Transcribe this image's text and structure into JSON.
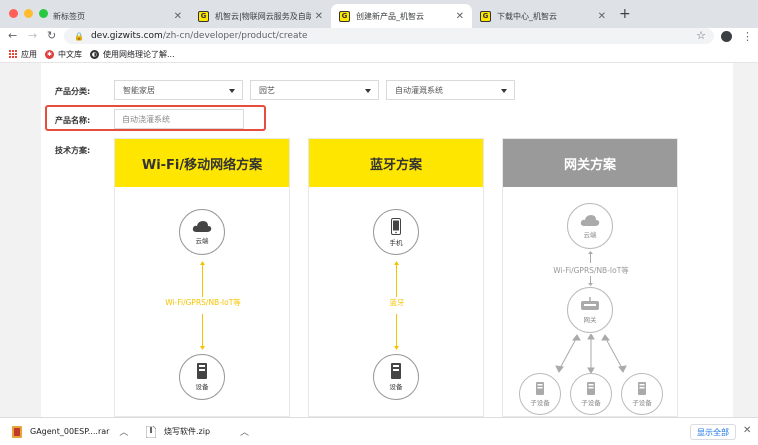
{
  "browser": {
    "tabs": [
      {
        "title": "新标签页",
        "active": false,
        "icon": "none"
      },
      {
        "title": "机智云|物联网云服务及自助开发",
        "active": false,
        "icon": "gizwits-favicon"
      },
      {
        "title": "创建新产品_机智云",
        "active": true,
        "icon": "gizwits-favicon"
      },
      {
        "title": "下载中心_机智云",
        "active": false,
        "icon": "gizwits-favicon"
      }
    ],
    "favicon_letter": "G",
    "url_host": "dev.gizwits.com",
    "url_path": "/zh-cn/developer/product/create",
    "bookmarks": [
      {
        "label": "应用",
        "icon": "apps-grid-icon"
      },
      {
        "label": "中文库",
        "icon": "xinhua-badge-icon"
      },
      {
        "label": "使用网络理论了解...",
        "icon": "globe-icon"
      }
    ]
  },
  "form": {
    "category_label": "产品分类:",
    "category_values": [
      "智能家居",
      "园艺",
      "自动灌溉系统"
    ],
    "name_label": "产品名称:",
    "name_value": "自动浇灌系统",
    "tech_label": "技术方案:"
  },
  "cards": [
    {
      "title": "Wi-Fi/移动网络方案",
      "theme": "yellow",
      "top_node": "云端",
      "connection": "Wi-Fi/GPRS/NB-IoT等",
      "bottom_node": "设备"
    },
    {
      "title": "蓝牙方案",
      "theme": "yellow",
      "top_node": "手机",
      "connection": "蓝牙",
      "bottom_node": "设备"
    },
    {
      "title": "网关方案",
      "theme": "grey",
      "top_node": "云端",
      "connection": "Wi-Fi/GPRS/NB-IoT等",
      "middle_node": "网关",
      "sub_nodes": [
        "子设备",
        "子设备",
        "子设备"
      ]
    }
  ],
  "downloads": [
    {
      "name": "GAgent_00ESP....rar",
      "icon": "rar-file-icon"
    },
    {
      "name": "烧写软件.zip",
      "icon": "zip-file-icon"
    }
  ],
  "download_bar": {
    "show_all": "显示全部"
  },
  "colors": {
    "accent_yellow": "#ffe600",
    "header_grey": "#9a9a9a",
    "highlight_red": "#e74c3c",
    "arrow_yellow": "#f5c400",
    "link_blue": "#1a73e8"
  }
}
